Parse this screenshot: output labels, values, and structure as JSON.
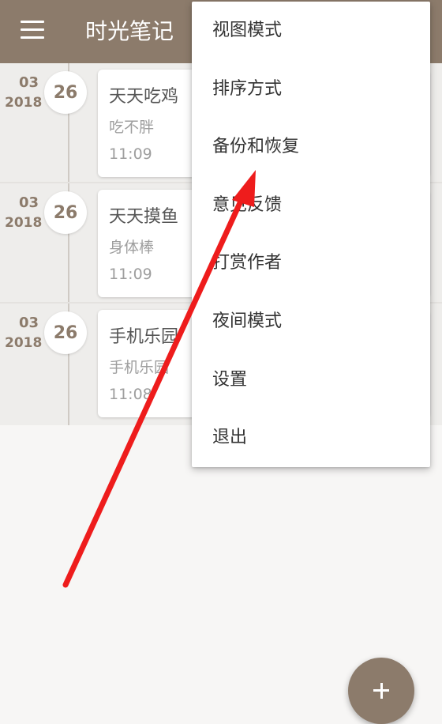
{
  "app": {
    "title": "时光笔记"
  },
  "entries": [
    {
      "month": "03",
      "year": "2018",
      "day": "26",
      "title": "天天吃鸡",
      "subtitle": "吃不胖",
      "time": "11:09"
    },
    {
      "month": "03",
      "year": "2018",
      "day": "26",
      "title": "天天摸鱼",
      "subtitle": "身体棒",
      "time": "11:09"
    },
    {
      "month": "03",
      "year": "2018",
      "day": "26",
      "title": "手机乐园",
      "subtitle": "手机乐园",
      "time": "11:08"
    }
  ],
  "menu": {
    "items": [
      "视图模式",
      "排序方式",
      "备份和恢复",
      "意见反馈",
      "打赏作者",
      "夜间模式",
      "设置",
      "退出"
    ]
  },
  "fab": {
    "icon": "plus-icon"
  },
  "annotation": {
    "color": "#ee1c1c"
  },
  "colors": {
    "primary": "#8c7b6b",
    "list_bg": "#eeedeb",
    "page_bg": "#f7f6f5"
  }
}
